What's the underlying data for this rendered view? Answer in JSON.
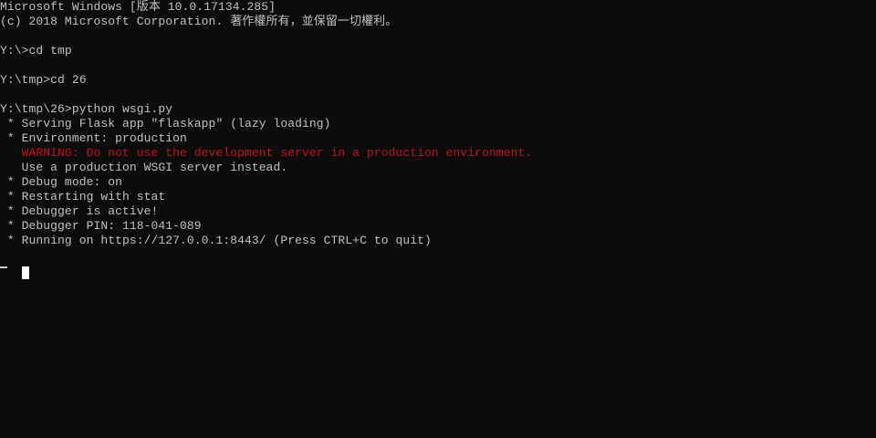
{
  "window": {
    "type": "command-prompt"
  },
  "console": {
    "lines": [
      {
        "text": "Microsoft Windows [版本 10.0.17134.285]",
        "kind": "normal"
      },
      {
        "text": "(c) 2018 Microsoft Corporation. 著作權所有，並保留一切權利。",
        "kind": "normal"
      },
      {
        "text": "",
        "kind": "normal"
      },
      {
        "text": "Y:\\>cd tmp",
        "kind": "normal"
      },
      {
        "text": "",
        "kind": "normal"
      },
      {
        "text": "Y:\\tmp>cd 26",
        "kind": "normal"
      },
      {
        "text": "",
        "kind": "normal"
      },
      {
        "text": "Y:\\tmp\\26>python wsgi.py",
        "kind": "normal"
      },
      {
        "text": " * Serving Flask app \"flaskapp\" (lazy loading)",
        "kind": "normal"
      },
      {
        "text": " * Environment: production",
        "kind": "normal"
      },
      {
        "text": "   WARNING: Do not use the development server in a production environment.",
        "kind": "warning"
      },
      {
        "text": "   Use a production WSGI server instead.",
        "kind": "normal"
      },
      {
        "text": " * Debug mode: on",
        "kind": "normal"
      },
      {
        "text": " * Restarting with stat",
        "kind": "normal"
      },
      {
        "text": " * Debugger is active!",
        "kind": "normal"
      },
      {
        "text": " * Debugger PIN: 118-041-089",
        "kind": "normal"
      },
      {
        "text": " * Running on https://127.0.0.1:8443/ (Press CTRL+C to quit)",
        "kind": "normal"
      }
    ]
  },
  "colors": {
    "background": "#0c0c0c",
    "text": "#c0c0c0",
    "warning": "#c50f1f",
    "cursor": "#ffffff"
  }
}
